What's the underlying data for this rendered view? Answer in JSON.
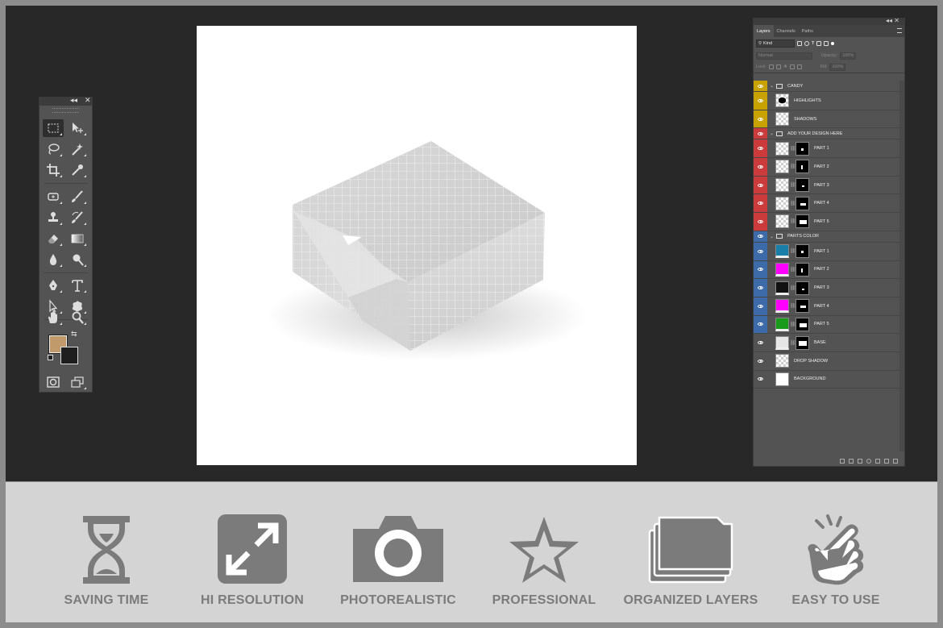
{
  "toolbox": {
    "collapse_icon": "double-chevron-left-icon",
    "close_icon": "close-icon",
    "foreground_color": "#c19a6b",
    "background_color": "#1e1e1e",
    "tools": [
      "rectangular-marquee",
      "move",
      "lasso",
      "magic-wand",
      "crop",
      "eyedropper",
      "healing-brush",
      "brush",
      "clone-stamp",
      "history-brush",
      "eraser",
      "gradient",
      "blur",
      "dodge",
      "pen",
      "type",
      "path-selection",
      "custom-shape",
      "hand",
      "zoom",
      "quick-mask",
      "screen-mode"
    ]
  },
  "layers_panel": {
    "tabs": [
      "Layers",
      "Channels",
      "Paths"
    ],
    "filter_kind": "Kind",
    "blend_mode": "Normal",
    "opacity_label": "Opacity:",
    "opacity_value": "100%",
    "lock_label": "Lock:",
    "fill_label": "Fill:",
    "fill_value": "100%",
    "layers": [
      {
        "name": "CANDY",
        "type": "group",
        "color": "#c8a200"
      },
      {
        "name": "HIGHLIGHTS",
        "type": "layer",
        "color": "#c8a200",
        "thumb": "blob"
      },
      {
        "name": "SHADOWS",
        "type": "layer",
        "color": "#c8a200",
        "thumb": "checker"
      },
      {
        "name": "ADD YOUR DESIGN HERE",
        "type": "group",
        "color": "#cc3b3b"
      },
      {
        "name": "PART 1",
        "type": "smart",
        "color": "#cc3b3b"
      },
      {
        "name": "PART 2",
        "type": "smart",
        "color": "#cc3b3b"
      },
      {
        "name": "PART 3",
        "type": "smart",
        "color": "#cc3b3b"
      },
      {
        "name": "PART 4",
        "type": "smart",
        "color": "#cc3b3b"
      },
      {
        "name": "PART 5",
        "type": "smart",
        "color": "#cc3b3b"
      },
      {
        "name": "PARTS COLOR",
        "type": "group",
        "color": "#3d6aa8"
      },
      {
        "name": "PART 1",
        "type": "fill",
        "color": "#3d6aa8",
        "fill": "#1a7fa8"
      },
      {
        "name": "PART 2",
        "type": "fill",
        "color": "#3d6aa8",
        "fill": "#ff00ff"
      },
      {
        "name": "PART 3",
        "type": "fill",
        "color": "#3d6aa8",
        "fill": "#111111"
      },
      {
        "name": "PART 4",
        "type": "fill",
        "color": "#3d6aa8",
        "fill": "#ff00ff"
      },
      {
        "name": "PART 5",
        "type": "fill",
        "color": "#3d6aa8",
        "fill": "#1a9a1a"
      },
      {
        "name": "BASE",
        "type": "masked",
        "color": "#535353",
        "fill": "#e6e6e6"
      },
      {
        "name": "DROP SHADOW",
        "type": "layer",
        "color": "#535353",
        "thumb": "checker"
      },
      {
        "name": "BACKGROUND",
        "type": "layer",
        "color": "#535353",
        "thumb": "white"
      }
    ]
  },
  "features": [
    {
      "label": "SAVING TIME",
      "icon": "hourglass-icon"
    },
    {
      "label": "HI RESOLUTION",
      "icon": "expand-arrows-icon"
    },
    {
      "label": "PHOTOREALISTIC",
      "icon": "camera-icon"
    },
    {
      "label": "PROFESSIONAL",
      "icon": "star-icon"
    },
    {
      "label": "ORGANIZED LAYERS",
      "icon": "stacked-folders-icon"
    },
    {
      "label": "EASY TO USE",
      "icon": "tapping-hand-icon"
    }
  ],
  "colors": {
    "icon_gray": "#7b7b7b",
    "strip_bg": "#d4d4d4",
    "workspace_bg": "#282828"
  }
}
